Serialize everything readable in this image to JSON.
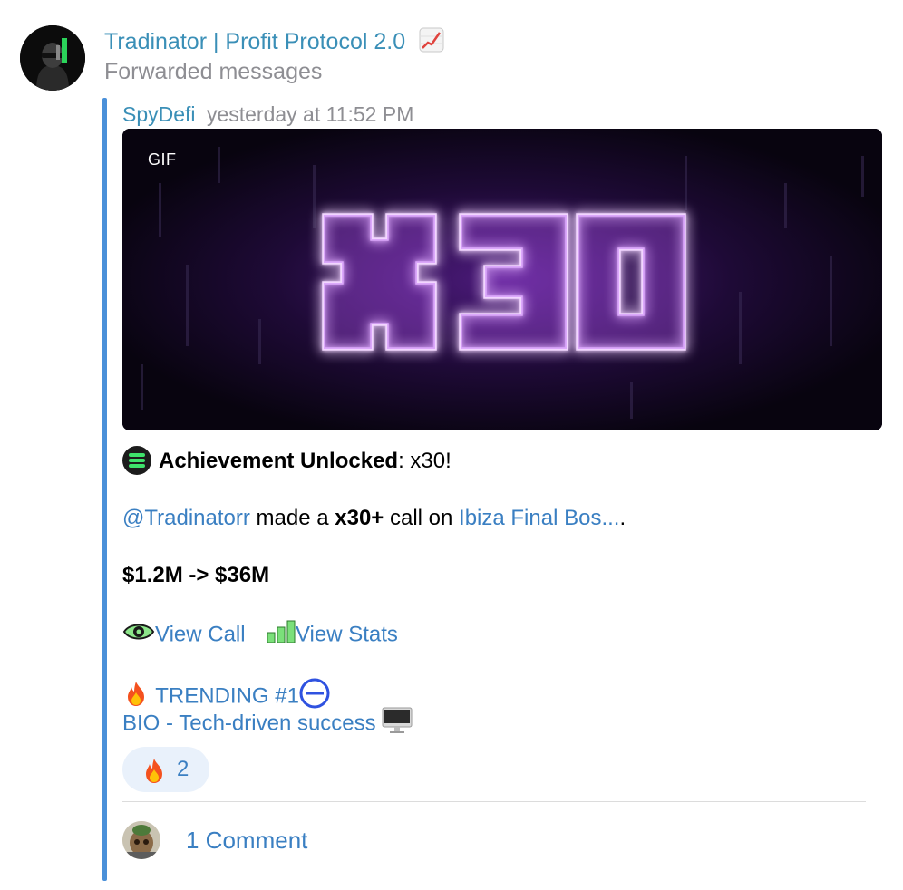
{
  "channel": {
    "title": "Tradinator | Profit Protocol 2.0",
    "title_emoji": "chart-increasing-icon",
    "subtitle": "Forwarded messages"
  },
  "forward": {
    "author": "SpyDefi",
    "timestamp": "yesterday at 11:52 PM"
  },
  "media": {
    "badge": "GIF",
    "neon_text": "x30",
    "neon_color": "#b455f5"
  },
  "message": {
    "achievement_bold": "Achievement Unlocked",
    "achievement_rest": ": x30!",
    "mention": "@Tradinatorr",
    "made_a": " made a ",
    "multiplier": "x30+",
    "call_on": " call on ",
    "token_link": "Ibiza Final Bos...",
    "token_suffix": ".",
    "mcap_change": "$1.2M -> $36M",
    "view_call": "View Call",
    "view_stats": "View Stats",
    "trending": "TRENDING #1",
    "bio": "BIO - Tech-driven success"
  },
  "reactions": [
    {
      "emoji": "fire-icon",
      "count": "2"
    }
  ],
  "comments": {
    "label": "1 Comment"
  },
  "colors": {
    "link": "#3a7fc2",
    "title": "#3a8fb7",
    "muted": "#8e8e93",
    "quote_bar": "#4a90d9",
    "reaction_bg": "#e9f1fb"
  }
}
